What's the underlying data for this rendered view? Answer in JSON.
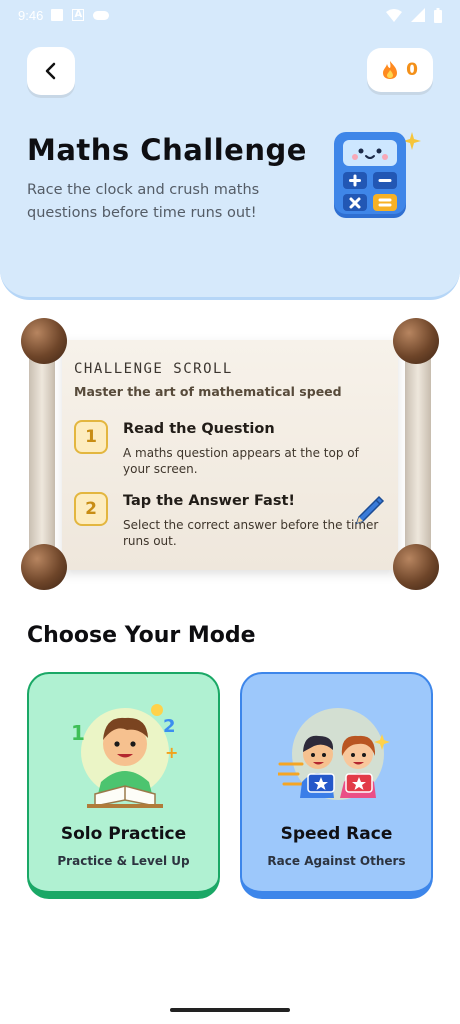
{
  "status_bar": {
    "time": "9:46"
  },
  "header": {
    "title": "Maths Challenge",
    "subtitle": "Race the clock and crush maths questions before time runs out!",
    "streak_count": "0",
    "icons": {
      "back": "chevron-left-icon",
      "streak": "flame-icon",
      "hero": "calculator-icon"
    }
  },
  "scroll": {
    "title": "CHALLENGE SCROLL",
    "subtitle": "Master the art of mathematical speed",
    "steps": [
      {
        "number": "1",
        "title": "Read the Question",
        "description": "A maths question appears at the top of your screen."
      },
      {
        "number": "2",
        "title": "Tap the Answer Fast!",
        "description": "Select the correct answer before the timer runs out."
      }
    ]
  },
  "modes": {
    "heading": "Choose Your Mode",
    "items": [
      {
        "title": "Solo Practice",
        "subtitle": "Practice & Level Up",
        "color": "#b0f1d2",
        "accent": "#1aa866"
      },
      {
        "title": "Speed Race",
        "subtitle": "Race Against Others",
        "color": "#9dc8fb",
        "accent": "#3d86ea"
      }
    ]
  },
  "colors": {
    "header_bg": "#d6e9fb",
    "streak": "#f39019"
  }
}
